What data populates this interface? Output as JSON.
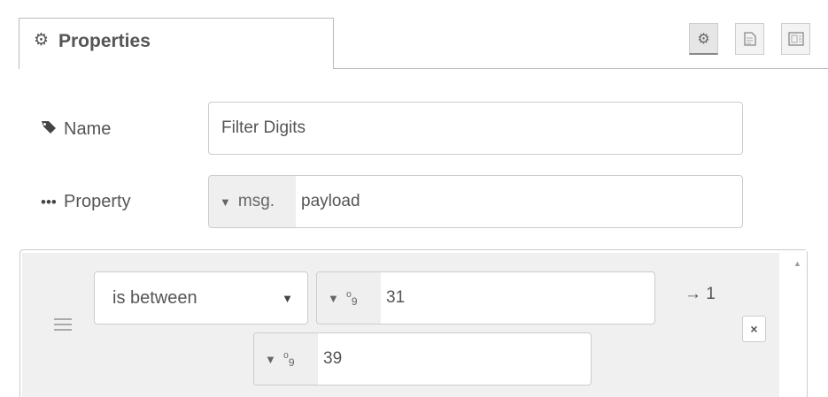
{
  "tabs": {
    "properties_label": "Properties",
    "toolbar_buttons": [
      {
        "icon": "gear-icon",
        "active": true
      },
      {
        "icon": "document-icon",
        "active": false
      },
      {
        "icon": "appearance-icon",
        "active": false
      }
    ]
  },
  "form": {
    "name_label": "Name",
    "name_value": "Filter Digits",
    "property_label": "Property",
    "property_type": "msg.",
    "property_value": "payload"
  },
  "rule": {
    "operator": "is between",
    "from_type_icon": "number-icon",
    "from_value": "31",
    "to_type_icon": "number-icon",
    "to_value": "39",
    "output": "→ 1",
    "delete_label": "×"
  }
}
